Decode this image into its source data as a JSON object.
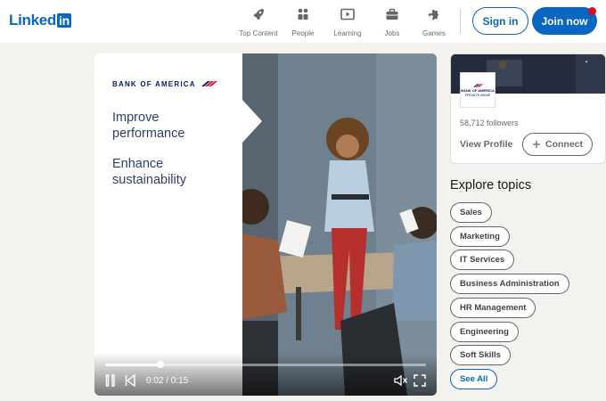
{
  "header": {
    "logo_text": "Linked",
    "logo_in": "in",
    "nav": [
      {
        "label": "Top Content",
        "icon": "rocket-icon"
      },
      {
        "label": "People",
        "icon": "people-icon"
      },
      {
        "label": "Learning",
        "icon": "play-video-icon"
      },
      {
        "label": "Jobs",
        "icon": "briefcase-icon"
      },
      {
        "label": "Games",
        "icon": "puzzle-icon"
      }
    ],
    "signin_label": "Sign in",
    "join_label": "Join now"
  },
  "video": {
    "brand": "BANK OF AMERICA",
    "headline_1": "Improve performance",
    "headline_2": "Enhance sustainability",
    "time": "0:02 / 0:15",
    "progress_fraction": 0.172,
    "controls": [
      "pause-icon",
      "replay-icon",
      "mute-icon",
      "fullscreen-icon"
    ]
  },
  "company": {
    "followers": "58,712 followers",
    "view_profile": "View Profile",
    "connect": "Connect",
    "logo_text_1": "BANK OF AMERICA",
    "logo_text_2": "PRIVATE BANK"
  },
  "topics": {
    "title": "Explore topics",
    "items": [
      "Sales",
      "Marketing",
      "IT Services",
      "Business Administration",
      "HR Management",
      "Engineering",
      "Soft Skills"
    ],
    "see_all": "See All"
  },
  "colors": {
    "brand_blue": "#0a66c2",
    "notification": "#d11124",
    "boa_navy": "#012169",
    "boa_red": "#e31837"
  }
}
